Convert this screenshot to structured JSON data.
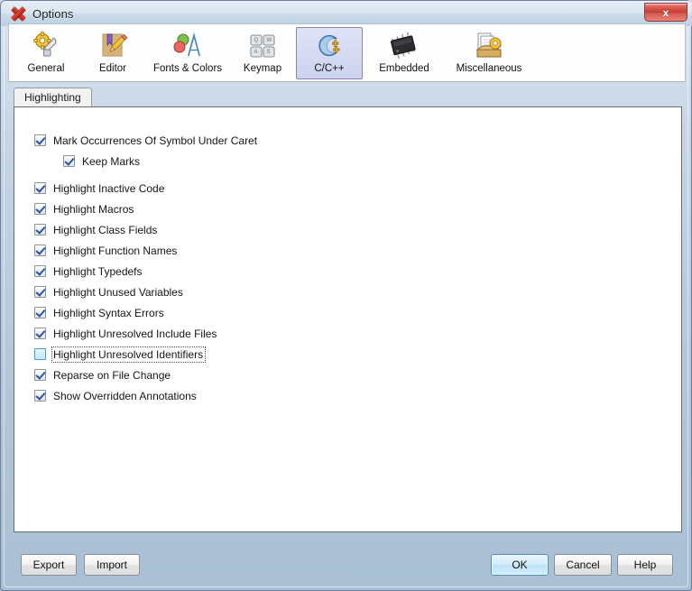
{
  "window": {
    "title": "Options",
    "app_icon": "red-x-icon",
    "close_label": "x"
  },
  "toolbar": {
    "items": [
      {
        "label": "General",
        "icon": "gear-wrench-icon",
        "selected": false
      },
      {
        "label": "Editor",
        "icon": "notebook-pencil-icon",
        "selected": false
      },
      {
        "label": "Fonts & Colors",
        "icon": "font-palette-icon",
        "selected": false
      },
      {
        "label": "Keymap",
        "icon": "keyboard-keys-icon",
        "selected": false
      },
      {
        "label": "C/C++",
        "icon": "c-plus-plus-icon",
        "selected": true
      },
      {
        "label": "Embedded",
        "icon": "chip-icon",
        "selected": false
      },
      {
        "label": "Miscellaneous",
        "icon": "documents-gear-icon",
        "selected": false
      }
    ]
  },
  "tabs": [
    {
      "label": "Highlighting",
      "active": true
    }
  ],
  "options": [
    {
      "label": "Mark Occurrences Of Symbol Under Caret",
      "checked": true,
      "indent": false,
      "gap": false,
      "focused": false
    },
    {
      "label": "Keep Marks",
      "checked": true,
      "indent": true,
      "gap": false,
      "focused": false
    },
    {
      "label": "Highlight Inactive Code",
      "checked": true,
      "indent": false,
      "gap": true,
      "focused": false
    },
    {
      "label": "Highlight Macros",
      "checked": true,
      "indent": false,
      "gap": false,
      "focused": false
    },
    {
      "label": "Highlight Class Fields",
      "checked": true,
      "indent": false,
      "gap": false,
      "focused": false
    },
    {
      "label": "Highlight Function Names",
      "checked": true,
      "indent": false,
      "gap": false,
      "focused": false
    },
    {
      "label": "Highlight Typedefs",
      "checked": true,
      "indent": false,
      "gap": false,
      "focused": false
    },
    {
      "label": "Highlight Unused Variables",
      "checked": true,
      "indent": false,
      "gap": false,
      "focused": false
    },
    {
      "label": "Highlight Syntax Errors",
      "checked": true,
      "indent": false,
      "gap": false,
      "focused": false
    },
    {
      "label": "Highlight Unresolved Include Files",
      "checked": true,
      "indent": false,
      "gap": false,
      "focused": false
    },
    {
      "label": "Highlight Unresolved Identifiers",
      "checked": false,
      "indent": false,
      "gap": false,
      "focused": true
    },
    {
      "label": "Reparse on File Change",
      "checked": true,
      "indent": false,
      "gap": false,
      "focused": false
    },
    {
      "label": "Show Overridden Annotations",
      "checked": true,
      "indent": false,
      "gap": false,
      "focused": false
    }
  ],
  "buttons": {
    "export": "Export",
    "import": "Import",
    "ok": "OK",
    "cancel": "Cancel",
    "help": "Help"
  },
  "colors": {
    "selected_tool_border": "#9481b6",
    "default_button_border": "#4a90c4",
    "focus_checkbox_border": "#4a9fd0",
    "check_mark": "#2a53a8",
    "close_button": "#c53b32"
  }
}
